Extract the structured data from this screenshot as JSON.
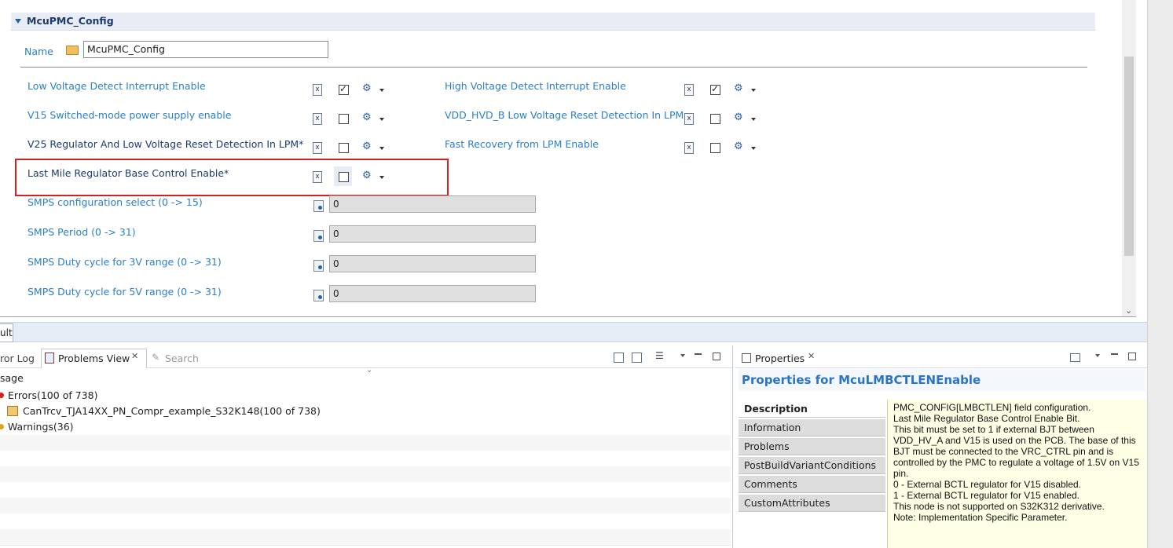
{
  "editor": {
    "section_title": "McuPMC_Config",
    "name_label": "Name",
    "name_value": "McuPMC_Config",
    "left_params": [
      {
        "label": "Low Voltage Detect Interrupt Enable",
        "checked": true
      },
      {
        "label": "V15 Switched-mode power supply enable",
        "checked": false
      },
      {
        "label": "V25 Regulator And Low Voltage Reset Detection In LPM*",
        "checked": false
      },
      {
        "label": "Last Mile Regulator Base Control Enable*",
        "checked": false
      }
    ],
    "right_params": [
      {
        "label": "High Voltage Detect Interrupt Enable",
        "checked": true
      },
      {
        "label": "VDD_HVD_B Low Voltage Reset Detection In LPM",
        "checked": false
      },
      {
        "label": "Fast Recovery from LPM Enable",
        "checked": false
      }
    ],
    "numeric_params": [
      {
        "label": "SMPS configuration select (0 -> 15)",
        "value": "0"
      },
      {
        "label": "SMPS Period (0 -> 31)",
        "value": "0"
      },
      {
        "label": "SMPS Duty cycle for 3V range (0 -> 31)",
        "value": "0"
      },
      {
        "label": "SMPS Duty cycle for 5V range (0 -> 31)",
        "value": "0"
      }
    ],
    "x_icon_glyph": "x"
  },
  "bottom_tab_partial": "ult",
  "problems": {
    "tabs": {
      "error_log": "ror Log",
      "problems_view": "Problems View",
      "search": "Search"
    },
    "column_header": "sage",
    "rows": [
      {
        "text": "Errors(100 of 738)",
        "kind": "error"
      },
      {
        "text": "CanTrcv_TJA14XX_PN_Compr_example_S32K148(100 of 738)",
        "kind": "project"
      },
      {
        "text": "Warnings(36)",
        "kind": "warning"
      }
    ]
  },
  "properties": {
    "tab_label": "Properties",
    "title": "Properties for McuLMBCTLENEnable",
    "tabs": [
      "Description",
      "Information",
      "Problems",
      "PostBuildVariantConditions",
      "Comments",
      "CustomAttributes"
    ],
    "description": "PMC_CONFIG[LMBCTLEN] field configuration.\nLast Mile Regulator Base Control Enable Bit.\nThis bit must be set to 1 if external BJT between VDD_HV_A and V15 is used on the PCB. The base of this BJT must be connected to the VRC_CTRL pin and is controlled by the PMC to regulate a voltage of 1.5V on V15 pin.\n0 - External BCTL regulator for V15 disabled.\n1 - External BCTL regulator for V15 enabled.\nThis node is not supported on S32K312 derivative.\nNote: Implementation Specific Parameter."
  }
}
